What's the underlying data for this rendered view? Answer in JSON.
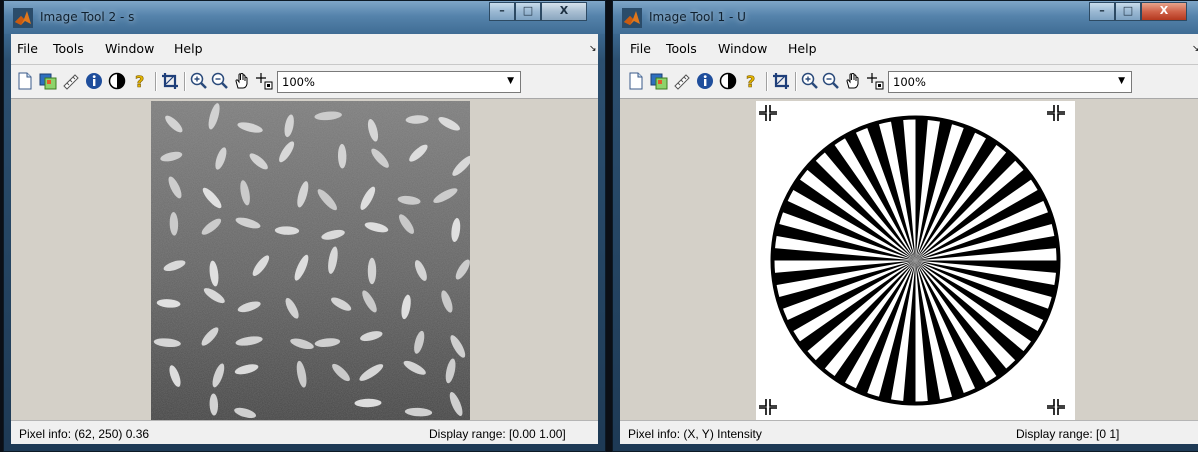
{
  "windows": [
    {
      "id": "image-tool-2",
      "title": "Image Tool 2 - s",
      "menu": [
        "File",
        "Tools",
        "Window",
        "Help"
      ],
      "menu_arrow": "↘",
      "zoom_value": "100%",
      "zoom_arrow": "▼",
      "status": {
        "pixel_info": "Pixel info: (62, 250)  0.36",
        "display_range": "Display range: [0.00 1.00]"
      },
      "image": "rice-grains-grayscale"
    },
    {
      "id": "image-tool-1",
      "title": "Image Tool 1 - U",
      "menu": [
        "File",
        "Tools",
        "Window",
        "Help"
      ],
      "menu_arrow": "↘",
      "zoom_value": "100%",
      "zoom_arrow": "▼",
      "status": {
        "pixel_info": "Pixel info: (X, Y)  Intensity",
        "display_range": "Display range: [0 1]"
      },
      "image": "siemens-star-binary"
    }
  ],
  "caption_buttons": {
    "minimize": "–",
    "maximize": "□",
    "close": "X"
  },
  "toolbar_icons": [
    "new-figure-icon",
    "export-icon",
    "measure-distance-icon",
    "image-info-icon",
    "contrast-icon",
    "help-icon",
    "crop-icon",
    "zoom-in-icon",
    "zoom-out-icon",
    "pan-hand-icon",
    "pixel-region-icon"
  ],
  "colors": {
    "title_gradient_top": "#7fa6c8",
    "title_gradient_bottom": "#3f6c94",
    "client_bg": "#d4d0c8",
    "bar_bg": "#f0f0f0",
    "close_red": "#c24b32"
  }
}
